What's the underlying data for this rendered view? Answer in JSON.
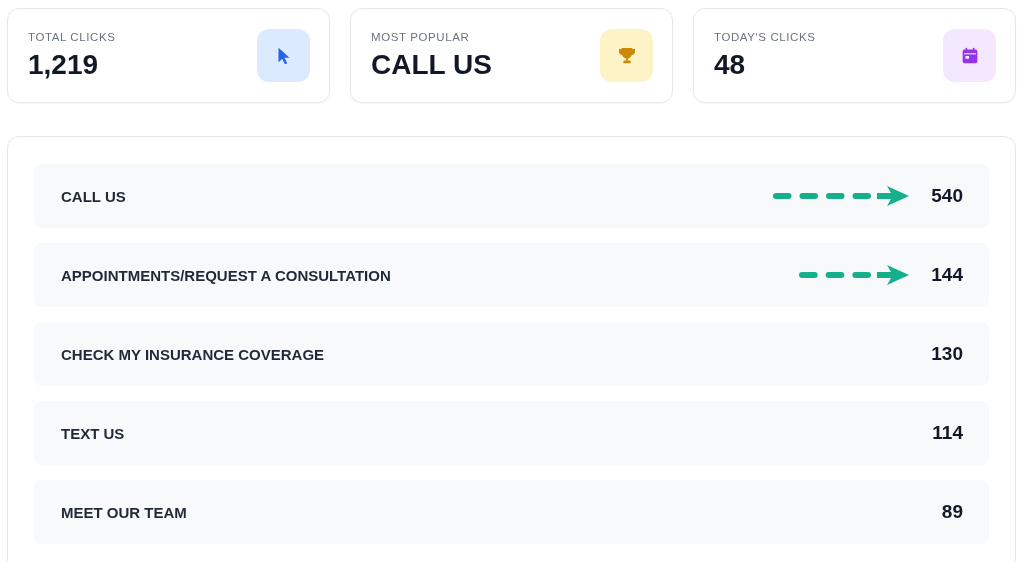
{
  "stats": [
    {
      "label": "TOTAL CLICKS",
      "value": "1,219",
      "kind": "cursor"
    },
    {
      "label": "MOST POPULAR",
      "value": "CALL US",
      "kind": "trophy"
    },
    {
      "label": "TODAY'S CLICKS",
      "value": "48",
      "kind": "calendar"
    }
  ],
  "rows": [
    {
      "label": "CALL US",
      "count": "540",
      "kind": "longarrow"
    },
    {
      "label": "APPOINTMENTS/REQUEST A CONSULTATION",
      "count": "144",
      "kind": "shortarrow"
    },
    {
      "label": "CHECK MY INSURANCE COVERAGE",
      "count": "130",
      "kind": "plain"
    },
    {
      "label": "TEXT US",
      "count": "114",
      "kind": "plain"
    },
    {
      "label": "MEET OUR TEAM",
      "count": "89",
      "kind": "plain"
    }
  ]
}
